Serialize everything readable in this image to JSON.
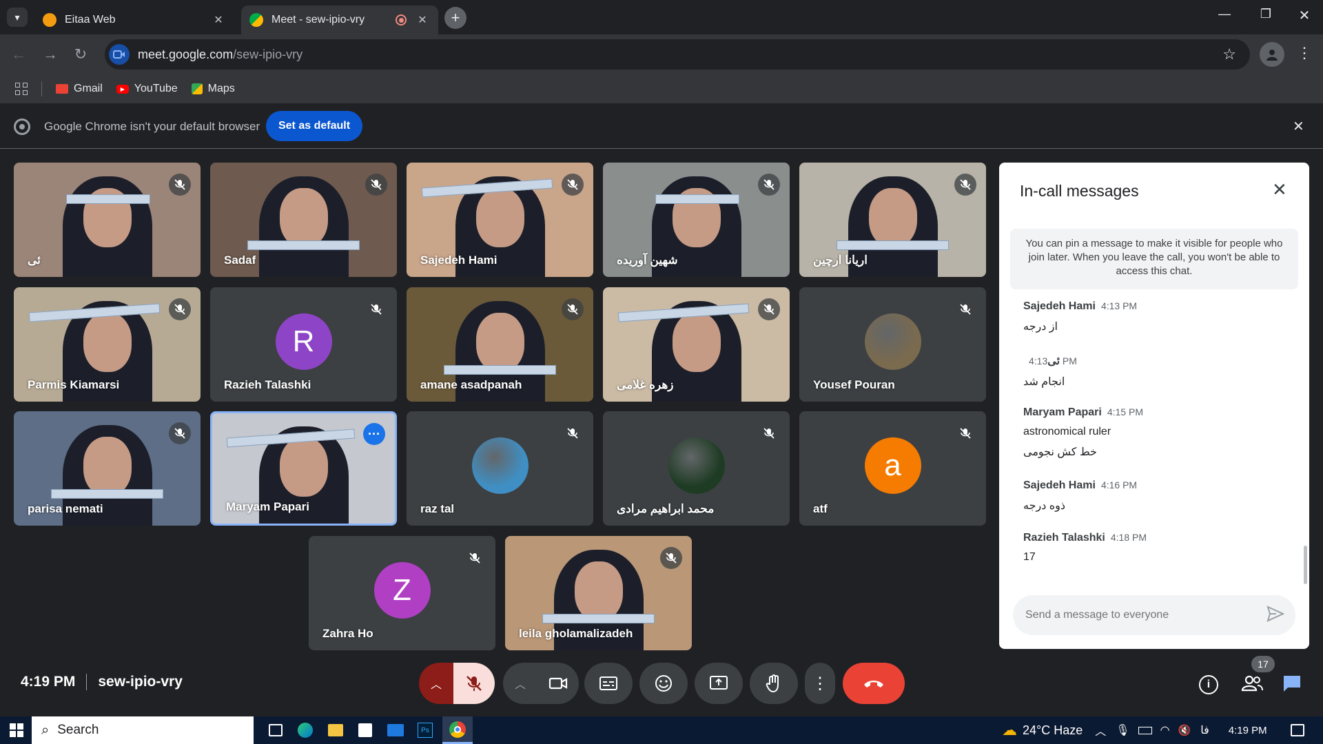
{
  "browser": {
    "tabs": [
      {
        "title": "Eitaa Web",
        "active": false
      },
      {
        "title": "Meet - sew-ipio-vry",
        "active": true
      }
    ],
    "url_domain": "meet.google.com",
    "url_path": "/sew-ipio-vry",
    "bookmarks": [
      "Gmail",
      "YouTube",
      "Maps"
    ],
    "infobar": {
      "message": "Google Chrome isn't your default browser",
      "button": "Set as default"
    }
  },
  "tiles": [
    {
      "name": "ئی",
      "type": "video",
      "bg": "#9b8478"
    },
    {
      "name": "Sadaf",
      "type": "video",
      "bg": "#6e5a4e"
    },
    {
      "name": "Sajedeh Hami",
      "type": "video",
      "bg": "#c9a58a"
    },
    {
      "name": "شهین آوریده",
      "type": "video",
      "bg": "#8a8f8e"
    },
    {
      "name": "اریانا ارچین",
      "type": "video",
      "bg": "#b8b3a8"
    },
    {
      "name": "Parmis Kiamarsi",
      "type": "video",
      "bg": "#b6aa94"
    },
    {
      "name": "Razieh Talashki",
      "type": "avatar",
      "letter": "R",
      "color": "#8e44c7"
    },
    {
      "name": "amane asadpanah",
      "type": "video",
      "bg": "#6b5a3a"
    },
    {
      "name": "زهره غلامی",
      "type": "video",
      "bg": "#cbbba5"
    },
    {
      "name": "Yousef Pouran",
      "type": "avatar-photo",
      "color": "#7a6a4e"
    },
    {
      "name": "parisa nemati",
      "type": "video",
      "bg": "#5d6e86"
    },
    {
      "name": "Maryam Papari",
      "type": "video",
      "bg": "#c5c8cf",
      "highlighted": true
    },
    {
      "name": "raz tal",
      "type": "avatar-photo",
      "color": "#3f8fc4"
    },
    {
      "name": "محمد ابراهیم مرادی",
      "type": "avatar-photo",
      "color": "#1e3b24"
    },
    {
      "name": "atf",
      "type": "avatar",
      "letter": "a",
      "color": "#f57c00"
    },
    {
      "name": "Zahra Ho",
      "type": "avatar",
      "letter": "Z",
      "color": "#b03fc4"
    },
    {
      "name": "leila gholamalizadeh",
      "type": "video",
      "bg": "#b99777"
    }
  ],
  "chat": {
    "title": "In-call messages",
    "notice": "You can pin a message to make it visible for people who join later. When you leave the call, you won't be able to access this chat.",
    "messages": [
      {
        "sender": "Sajedeh Hami",
        "time": "4:13 PM",
        "lines": [
          "از درجه"
        ]
      },
      {
        "sender": "ئی",
        "time": "4:13 PM",
        "lines": [
          "انجام شد"
        ]
      },
      {
        "sender": "Maryam Papari",
        "time": "4:15 PM",
        "lines": [
          "astronomical ruler",
          "خط کش نجومی"
        ]
      },
      {
        "sender": "Sajedeh Hami",
        "time": "4:16 PM",
        "lines": [
          "ذوه درجه"
        ]
      },
      {
        "sender": "Razieh Talashki",
        "time": "4:18 PM",
        "lines": [
          "17"
        ]
      }
    ],
    "input_placeholder": "Send a message to everyone"
  },
  "meeting": {
    "time": "4:19 PM",
    "code": "sew-ipio-vry",
    "participant_count": "17"
  },
  "taskbar": {
    "search": "Search",
    "weather": "24°C Haze",
    "lang": "فا",
    "clock": "4:19 PM"
  },
  "colors": {
    "accent": "#8ab4f8",
    "end_call": "#ea4335",
    "mic_off": "#f9dedc"
  }
}
